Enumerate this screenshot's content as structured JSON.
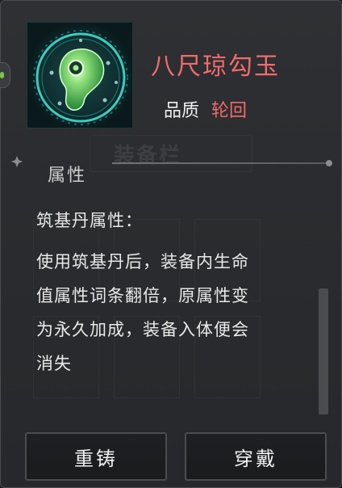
{
  "item": {
    "name": "八尺琼勾玉",
    "icon": "jade-magatama-icon",
    "quality_label": "品质",
    "quality_value": "轮回"
  },
  "background": {
    "ghost_title": "装备栏"
  },
  "attributes": {
    "section_title": "属性",
    "description_lines": [
      "筑基丹属性：",
      "使用筑基丹后，装备内生命",
      "值属性词条翻倍，原属性变",
      "为永久加成，装备入体便会",
      "消失"
    ]
  },
  "buttons": {
    "recast_label": "重铸",
    "equip_label": "穿戴"
  },
  "colors": {
    "name_color": "#f16b6b",
    "quality_color": "#f16b6b",
    "panel_bg": "#2e3033",
    "icon_glow": "#3fe0d0"
  }
}
